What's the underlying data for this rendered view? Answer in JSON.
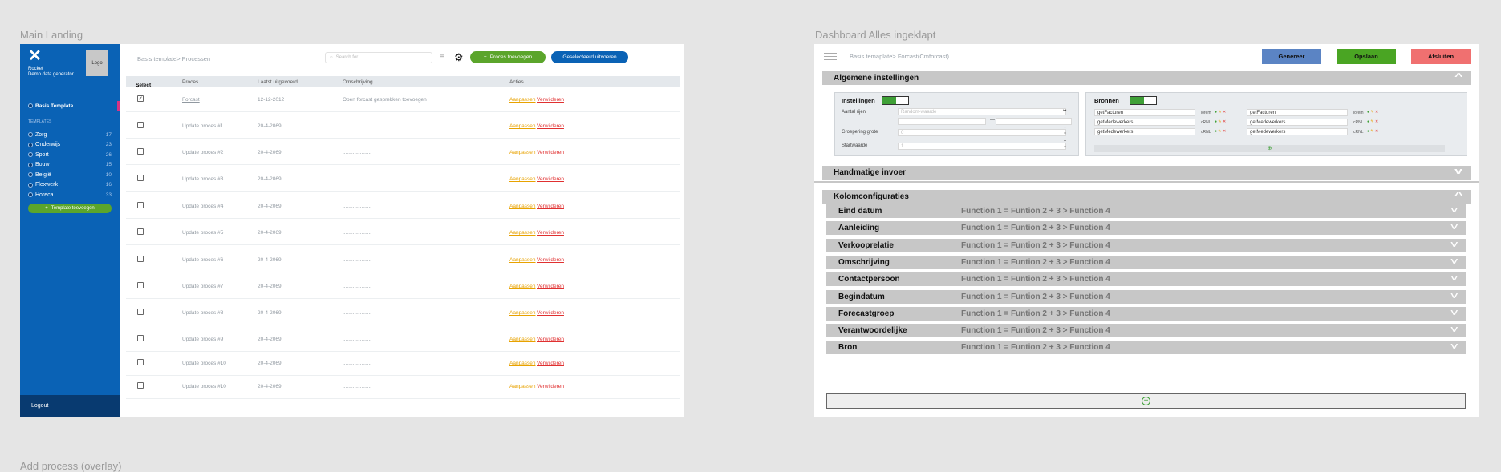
{
  "frames": {
    "main_landing_title": "Main Landing",
    "dashboard_title": "Dashboard Alles ingeklapt",
    "overlay_title": "Add process (overlay)"
  },
  "landing": {
    "sidebar": {
      "logo_mark": "✕",
      "brand_line1": "Rocket",
      "brand_line2": "Demo data generator",
      "logo_label": "Logo",
      "basis_template": "Basis Template",
      "templates_heading": "TEMPLATES",
      "templates": [
        {
          "name": "Zorg",
          "count": "17"
        },
        {
          "name": "Onderwijs",
          "count": "23"
        },
        {
          "name": "Sport",
          "count": "26"
        },
        {
          "name": "Bouw",
          "count": "15"
        },
        {
          "name": "België",
          "count": "10"
        },
        {
          "name": "Flexwerk",
          "count": "16"
        },
        {
          "name": "Horeca",
          "count": "33"
        }
      ],
      "add_template": "Template toevoegen",
      "logout": "Logout"
    },
    "header": {
      "breadcrumb": "Basis template> Processen",
      "search_placeholder": "Search for...",
      "add_process": "Proces toevoegen",
      "execute_selected": "Geselecteerd uitvoeren"
    },
    "table": {
      "headers": {
        "select": "Select",
        "process": "Proces",
        "last_run": "Laatst uitgevoerd",
        "description": "Omschrijving",
        "actions": "Acties"
      },
      "action_edit": "Aanpassen",
      "action_delete": "Verwijderen",
      "rows": [
        {
          "checked": "✓",
          "name": "Forcast",
          "date": "12-12-2012",
          "desc": "Open forcast gesprekken toevoegen"
        },
        {
          "checked": "",
          "name": "Update proces #1",
          "date": "20-4-2069",
          "desc": "...................."
        },
        {
          "checked": "",
          "name": "Update proces #2",
          "date": "20-4-2069",
          "desc": "...................."
        },
        {
          "checked": "",
          "name": "Update proces #3",
          "date": "20-4-2069",
          "desc": "...................."
        },
        {
          "checked": "",
          "name": "Update proces #4",
          "date": "20-4-2069",
          "desc": "...................."
        },
        {
          "checked": "",
          "name": "Update proces #5",
          "date": "20-4-2069",
          "desc": "...................."
        },
        {
          "checked": "",
          "name": "Update proces #6",
          "date": "20-4-2069",
          "desc": "...................."
        },
        {
          "checked": "",
          "name": "Update proces #7",
          "date": "20-4-2069",
          "desc": "...................."
        },
        {
          "checked": "",
          "name": "Update proces #8",
          "date": "20-4-2069",
          "desc": "...................."
        },
        {
          "checked": "",
          "name": "Update proces #9",
          "date": "20-4-2069",
          "desc": "...................."
        },
        {
          "checked": "",
          "name": "Update proces #10",
          "date": "20-4-2069",
          "desc": "...................."
        },
        {
          "checked": "",
          "name": "Update proces #10",
          "date": "20-4-2069",
          "desc": "...................."
        }
      ]
    }
  },
  "dashboard": {
    "breadcrumb": "Basis temaplate> Forcast(Cmforcast)",
    "buttons": {
      "generate": "Genereer",
      "save": "Opslaan",
      "close": "Afsluiten"
    },
    "colors": {
      "generate": "#5b84c4",
      "save": "#4aa523",
      "close": "#f07070"
    },
    "general_settings": "Algemene instellingen",
    "settings": {
      "title": "Instellingen",
      "fields": [
        {
          "label": "Aantal rijen",
          "value": "Random-waarde"
        },
        {
          "label": "Groepering grote",
          "value": "0"
        },
        {
          "label": "Startwaarde",
          "value": "1"
        }
      ],
      "range_sep": "—"
    },
    "sources": {
      "title": "Bronnen",
      "left": [
        {
          "name": "getFacturen",
          "tag": "lorem"
        },
        {
          "name": "getMedewerkers",
          "tag": "cRNL"
        },
        {
          "name": "getMedewerkers",
          "tag": "cRNL"
        }
      ],
      "right": [
        {
          "name": "getFacturen",
          "tag": "lorem"
        },
        {
          "name": "getMedewerkers",
          "tag": "cRNL"
        },
        {
          "name": "getMedewerkers",
          "tag": "cRNL"
        }
      ]
    },
    "manual_input": "Handmatige invoer",
    "column_config": "Kolomconfiguraties",
    "columns": [
      {
        "name": "Eind datum",
        "fn": "Function 1 = Funtion 2 + 3 > Function 4"
      },
      {
        "name": "Aanleiding",
        "fn": "Function 1 = Funtion 2 + 3 > Function 4"
      },
      {
        "name": "Verkooprelatie",
        "fn": "Function 1 = Funtion 2 + 3 > Function 4"
      },
      {
        "name": "Omschrijving",
        "fn": "Function 1 = Funtion 2 + 3 > Function 4"
      },
      {
        "name": "Contactpersoon",
        "fn": "Function 1 = Funtion 2 + 3 > Function 4"
      },
      {
        "name": "Begindatum",
        "fn": "Function 1 = Funtion 2 + 3 > Function 4"
      },
      {
        "name": "Forecastgroep",
        "fn": "Function 1 = Funtion 2 + 3 > Function 4"
      },
      {
        "name": "Verantwoordelijke",
        "fn": "Function 1 = Funtion 2 + 3 > Function 4"
      },
      {
        "name": "Bron",
        "fn": "Function 1 = Funtion 2 + 3 > Function 4"
      }
    ],
    "add_column_icon": "+"
  }
}
